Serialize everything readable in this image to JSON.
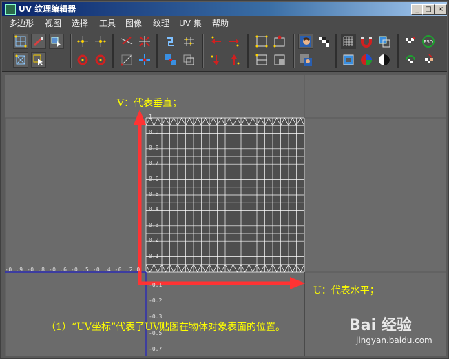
{
  "window": {
    "title": "UV 纹理编辑器",
    "controls": {
      "minimize": "_",
      "maximize": "□",
      "close": "×"
    }
  },
  "menu": {
    "items": [
      {
        "label": "多边形"
      },
      {
        "label": "视图"
      },
      {
        "label": "选择"
      },
      {
        "label": "工具"
      },
      {
        "label": "图像"
      },
      {
        "label": "纹理"
      },
      {
        "label": "UV 集"
      },
      {
        "label": "帮助"
      }
    ]
  },
  "toolbar": {
    "icons": [
      "uv-grid-select-icon",
      "paint-brush-icon",
      "move-select-icon",
      "uv-lattice-icon",
      "select-arrow-icon",
      "move-uv-left-icon",
      "move-uv-right-icon",
      "rotate-ccw-icon",
      "rotate-cw-icon",
      "cut-uv-icon",
      "split-uv-icon",
      "align-icon",
      "mirror-icon",
      "sew-uv-icon",
      "layout-uv-icon",
      "move-sew-icon",
      "stack-icon",
      "arrow-left-icon",
      "arrow-right-icon",
      "arrow-down-icon",
      "arrow-up-icon",
      "snap-grid-icon",
      "snap-point-icon",
      "snap-align-icon",
      "snap-box-icon",
      "image-display-icon",
      "checker-icon",
      "texture-swap-icon",
      "grid-toggle-icon",
      "magnet-icon",
      "copy-uv-icon",
      "frame-icon",
      "rgb-channels-icon",
      "contrast-icon",
      "checker-toggle-icon",
      "psd-network-icon",
      "refresh-icon",
      "texture-paint-icon"
    ]
  },
  "viewport": {
    "u_labels": [
      "-0",
      "9",
      "-0",
      "8",
      "-0",
      "6",
      "-0",
      "5",
      "-0",
      "4",
      "-0",
      "2",
      "0"
    ],
    "u_axis_text": "-0 .9 -0 .8 -0 .6 -0 .5 -0 .4 -0 .2 0",
    "v_labels_pos": [
      "1",
      "0.9",
      "0.8",
      "0.7",
      "0.6",
      "0.5",
      "0.4",
      "0.3",
      "0.2",
      "0.1"
    ],
    "v_labels_neg": [
      "-0.1",
      "-0.2",
      "-0.3",
      "-0.5",
      "-0.7"
    ]
  },
  "annotations": {
    "v_label": "V：代表垂直；",
    "u_label": "U：代表水平；",
    "caption": "（1）“UV坐标”代表了UV贴图在物体对象表面的位置。"
  },
  "watermark": {
    "brand": "Bai 经验",
    "url": "jingyan.baidu.com"
  },
  "colors": {
    "annotation": "#ffff00",
    "arrow": "#ff3333",
    "uv_shell": "#ffffff",
    "axis": "#2020c0"
  }
}
